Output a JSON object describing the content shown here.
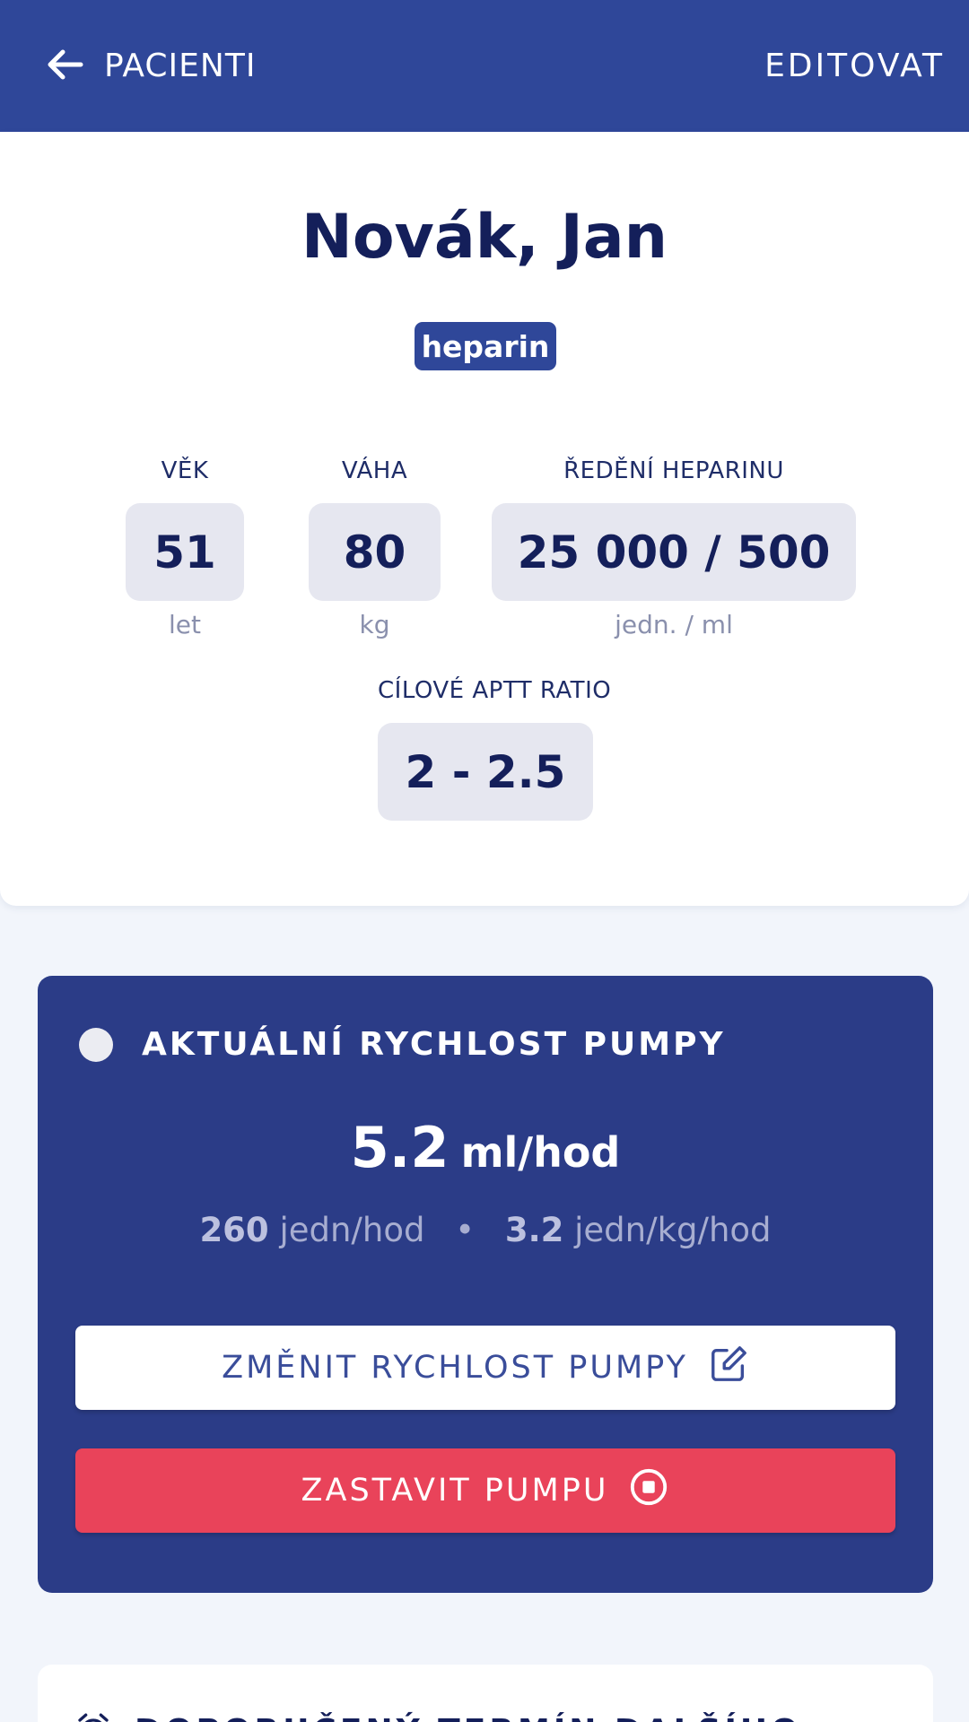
{
  "header": {
    "back_label": "PACIENTI",
    "edit_label": "EDITOVAT"
  },
  "patient": {
    "name": "Novák, Jan",
    "drug_badge": "heparin",
    "age": {
      "label": "VĚK",
      "value": "51",
      "unit": "let"
    },
    "weight": {
      "label": "VÁHA",
      "value": "80",
      "unit": "kg"
    },
    "dilution": {
      "label": "ŘEDĚNÍ HEPARINU",
      "value": "25 000 / 500",
      "unit": "jedn. / ml"
    },
    "aptt": {
      "label": "CÍLOVÉ APTT RATIO",
      "value": "2 - 2.5"
    }
  },
  "pump": {
    "title": "AKTUÁLNÍ RYCHLOST PUMPY",
    "rate_value": "5.2",
    "rate_unit": "ml/hod",
    "units_value": "260",
    "units_label": "jedn/hod",
    "separator": "•",
    "per_kg_value": "3.2",
    "per_kg_label": "jedn/kg/hod",
    "change_button": "ZMĚNIT RYCHLOST PUMPY",
    "stop_button": "ZASTAVIT PUMPU"
  },
  "next_check": {
    "title": "DOPORUČENÝ TERMÍN DALŠÍHO"
  },
  "colors": {
    "header_bg": "#2f4799",
    "pump_card_bg": "#2b3c87",
    "stop_button_bg": "#e9435a",
    "stat_box_bg": "#e6e7f0",
    "text_dark": "#141f5a"
  },
  "icons": {
    "back": "arrow-left-icon",
    "status": "status-dot-icon",
    "edit": "edit-icon",
    "stop": "stop-circle-icon",
    "alarm": "alarm-clock-icon"
  }
}
